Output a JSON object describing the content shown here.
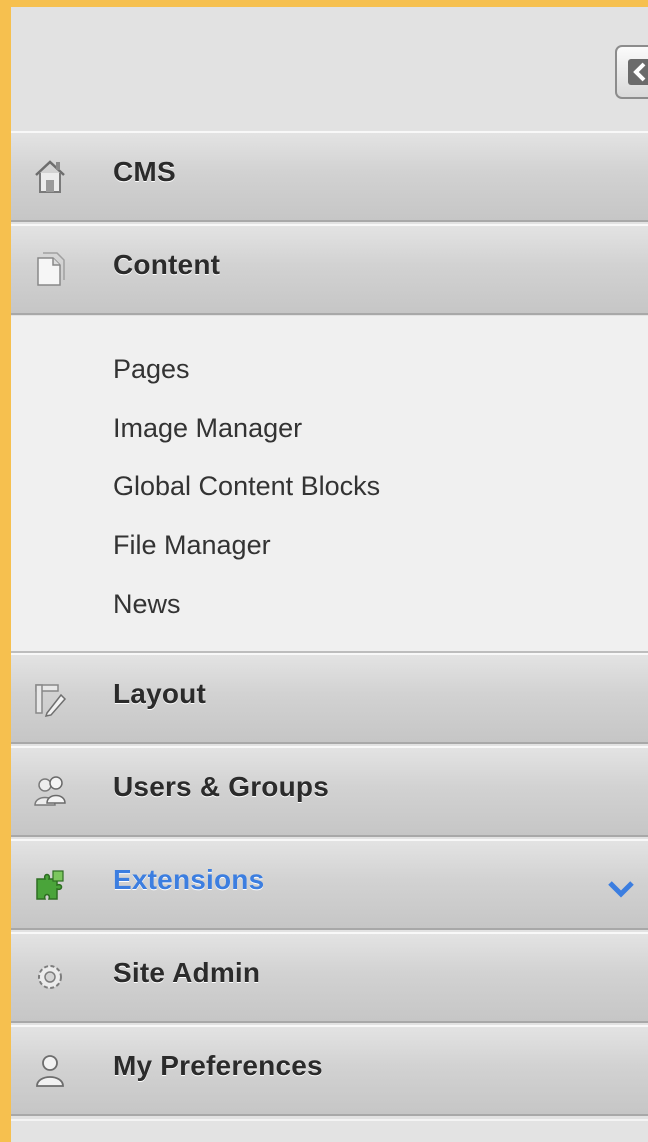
{
  "sidebar": {
    "collapse_icon": "arrow-left-icon",
    "sections": [
      {
        "label": "CMS",
        "icon": "home-icon"
      },
      {
        "label": "Content",
        "icon": "document-icon"
      },
      {
        "label": "Layout",
        "icon": "layout-icon"
      },
      {
        "label": "Users & Groups",
        "icon": "users-icon"
      },
      {
        "label": "Extensions",
        "icon": "puzzle-icon",
        "active": true,
        "indicator": "chevron-down-icon"
      },
      {
        "label": "Site Admin",
        "icon": "gear-icon"
      },
      {
        "label": "My Preferences",
        "icon": "user-icon"
      }
    ],
    "content_items": [
      {
        "label": "Pages"
      },
      {
        "label": "Image Manager"
      },
      {
        "label": "Global Content Blocks"
      },
      {
        "label": "File Manager"
      },
      {
        "label": "News"
      }
    ]
  },
  "colors": {
    "frame": "#f6c04f",
    "active_text": "#3c7ee0",
    "text": "#2b2b2b"
  }
}
